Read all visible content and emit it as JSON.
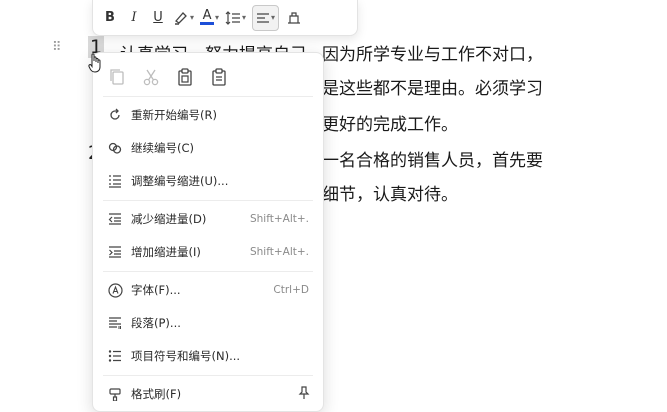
{
  "toolbar": {
    "bold": "B",
    "italic": "I",
    "underline": "U",
    "font_color": "A",
    "font_color_accent": "#1d4fd8"
  },
  "document": {
    "list_numbers": [
      "1",
      "2"
    ],
    "lines": [
      "认真学习，努力提高自己，因为所学专业与工作不对口，",
      "但是这些都不是理由。必须学习",
      "更好的完成工作。",
      "一名合格的销售人员，首先要",
      "细节，认真对待。"
    ],
    "line1_prefix": "认真学习，努力提高自己，",
    "line1_suffix": "因为所学专业与工作不对口，",
    "line2_visible": "是这些都不是理由。必须学习",
    "line3_visible": "更好的完成工作。",
    "line4_visible": "一名合格的销售人员，首先要",
    "line5_visible": "细节，认真对待。"
  },
  "menu": {
    "items": [
      {
        "label": "重新开始编号(R)",
        "shortcut": ""
      },
      {
        "label": "继续编号(C)",
        "shortcut": ""
      },
      {
        "label": "调整编号缩进(U)...",
        "shortcut": ""
      },
      {
        "label": "减少缩进量(D)",
        "shortcut": "Shift+Alt+."
      },
      {
        "label": "增加缩进量(I)",
        "shortcut": "Shift+Alt+."
      },
      {
        "label": "字体(F)...",
        "shortcut": "Ctrl+D"
      },
      {
        "label": "段落(P)...",
        "shortcut": ""
      },
      {
        "label": "项目符号和编号(N)...",
        "shortcut": ""
      },
      {
        "label": "格式刷(F)",
        "shortcut": ""
      }
    ]
  }
}
